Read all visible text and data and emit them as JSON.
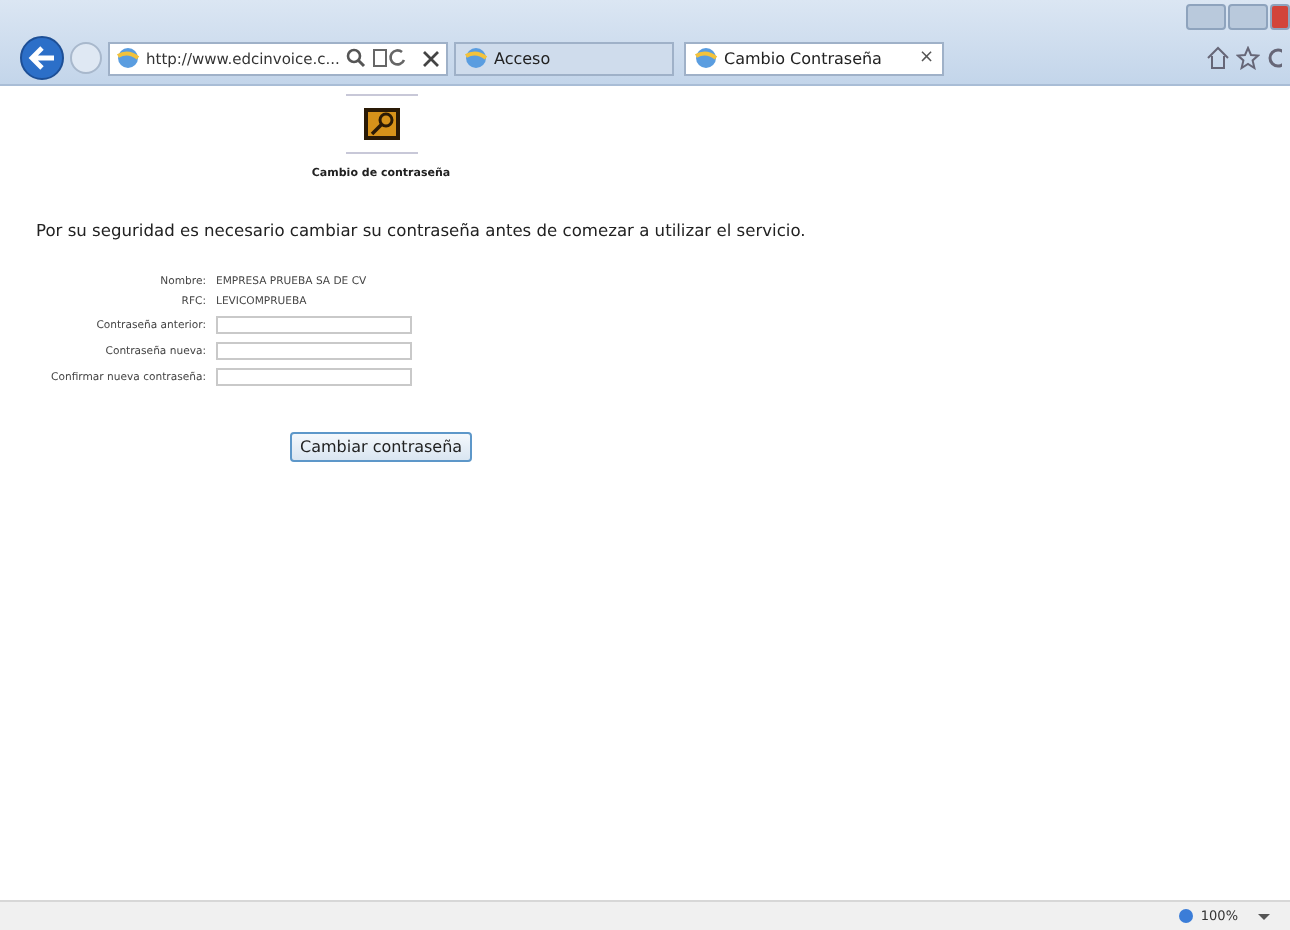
{
  "browser": {
    "address": "http://www.edcinvoice.c...",
    "tabs": [
      {
        "label": "Acceso",
        "selected": false
      },
      {
        "label": "Cambio Contraseña",
        "selected": true,
        "close": "×"
      }
    ],
    "zoom": "100%"
  },
  "page": {
    "title": "Cambio de contraseña",
    "message": "Por su seguridad es necesario cambiar su contraseña antes de comezar a utilizar el servicio.",
    "info": [
      {
        "label": "Nombre:",
        "value": "EMPRESA PRUEBA SA DE CV"
      },
      {
        "label": "RFC:",
        "value": "LEVICOMPRUEBA"
      }
    ],
    "fields": [
      {
        "label": "Contraseña anterior:"
      },
      {
        "label": "Contraseña nueva:"
      },
      {
        "label": "Confirmar nueva contraseña:"
      }
    ],
    "button": "Cambiar contraseña"
  }
}
